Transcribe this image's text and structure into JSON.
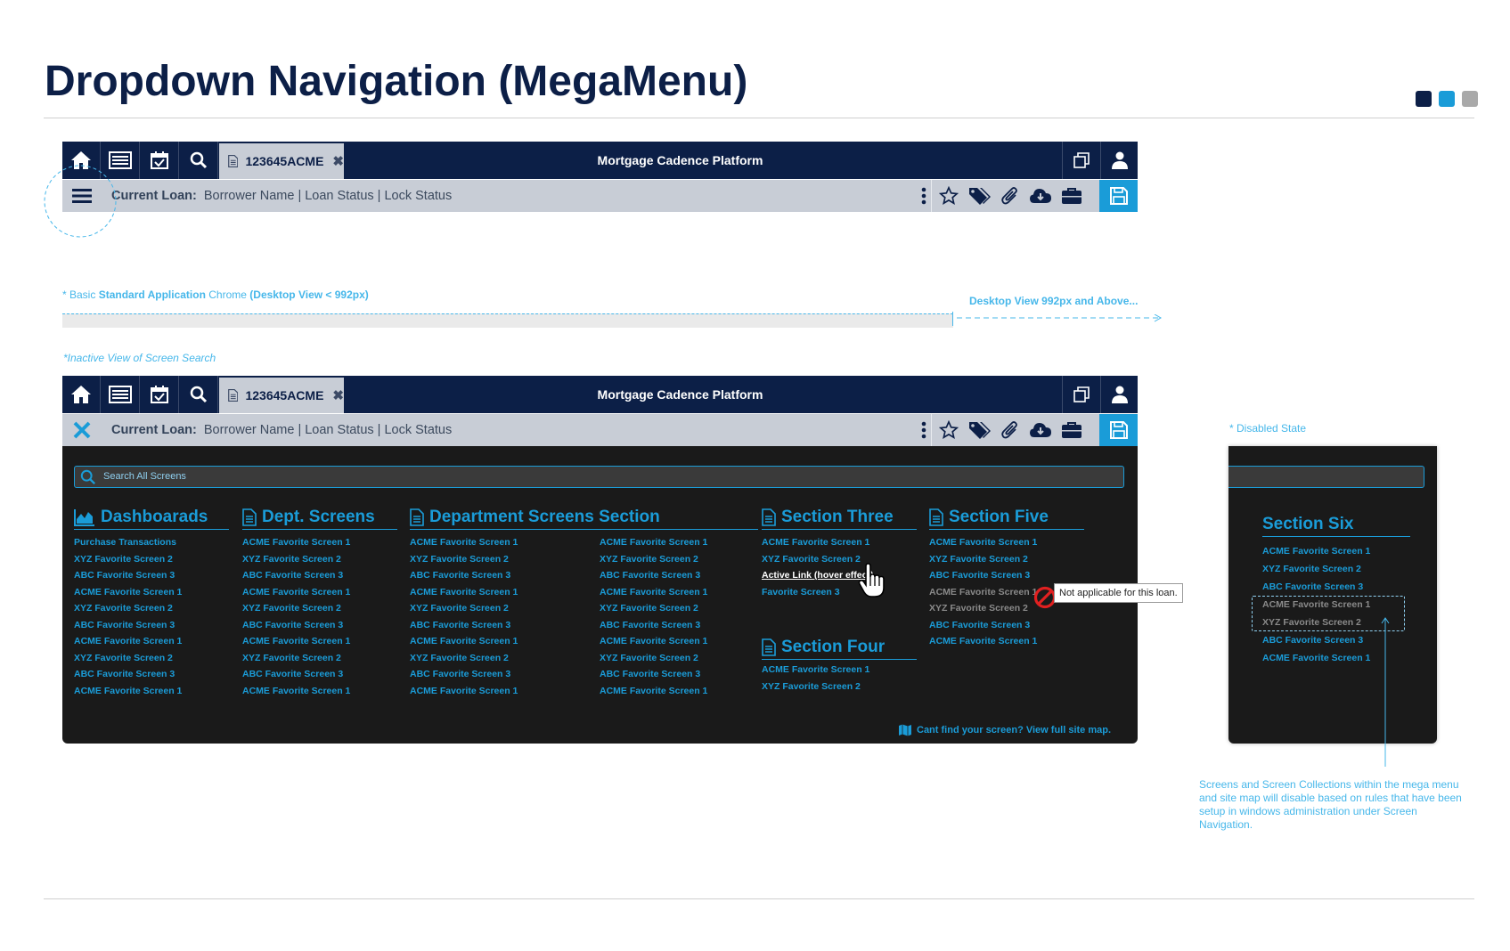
{
  "page": {
    "title": "Dropdown Navigation (MegaMenu)",
    "swatches": [
      "#0c1f47",
      "#1a9cd8",
      "#a9a9a9"
    ]
  },
  "app": {
    "tab_label": "123645ACME",
    "title": "Mortgage Cadence Platform",
    "current_loan_label": "Current Loan:",
    "loan_info": "Borrower Name | Loan Status | Lock Status",
    "icons": [
      "home-icon",
      "list-icon",
      "calendar-icon",
      "search-icon",
      "document-icon",
      "close-icon",
      "copy-window-icon",
      "user-icon",
      "hamburger-icon",
      "kebab-icon",
      "star-icon",
      "tags-icon",
      "paperclip-icon",
      "cloud-download-icon",
      "briefcase-icon",
      "save-icon"
    ]
  },
  "annotations": {
    "basic_chrome_prefix": "* Basic ",
    "basic_chrome_bold": "Standard Application",
    "basic_chrome_mid": " Chrome ",
    "basic_chrome_view": "(Desktop View < 992px)",
    "desktop_above": "Desktop View 992px and Above...",
    "inactive_view": "*Inactive View of Screen Search",
    "disabled_state": "* Disabled State",
    "disable_rule": "Screens and Screen Collections within the mega menu and site map will disable based on rules that have been setup in windows administration under Screen Navigation.",
    "tooltip": "Not applicable for this loan."
  },
  "mega_menu": {
    "search_placeholder": "Search All Screens",
    "columns": [
      {
        "heading": "Dashboarads",
        "icon": "area-chart-icon",
        "links": [
          "Purchase Transactions",
          "XYZ Favorite Screen 2",
          "ABC Favorite Screen 3",
          "ACME Favorite Screen 1",
          "XYZ Favorite Screen 2",
          "ABC Favorite Screen 3",
          "ACME Favorite Screen 1",
          "XYZ Favorite Screen 2",
          "ABC Favorite Screen 3",
          "ACME Favorite Screen 1"
        ]
      },
      {
        "heading": "Dept. Screens",
        "icon": "document-icon",
        "links": [
          "ACME Favorite Screen 1",
          "XYZ Favorite Screen 2",
          "ABC Favorite Screen 3",
          "ACME Favorite Screen 1",
          "XYZ Favorite Screen 2",
          "ABC Favorite Screen 3",
          "ACME Favorite Screen 1",
          "XYZ Favorite Screen 2",
          "ABC Favorite Screen 3",
          "ACME Favorite Screen 1"
        ]
      },
      {
        "heading": "Department Screens Section",
        "icon": "document-icon",
        "links": [
          "ACME Favorite Screen 1",
          "XYZ Favorite Screen 2",
          "ABC Favorite Screen 3",
          "ACME Favorite Screen 1",
          "XYZ Favorite Screen 2",
          "ABC Favorite Screen 3",
          "ACME Favorite Screen 1",
          "XYZ Favorite Screen 2",
          "ABC Favorite Screen 3",
          "ACME Favorite Screen 1"
        ],
        "links2": [
          "ACME Favorite Screen 1",
          "XYZ Favorite Screen 2",
          "ABC Favorite Screen 3",
          "ACME Favorite Screen 1",
          "XYZ Favorite Screen 2",
          "ABC Favorite Screen 3",
          "ACME Favorite Screen 1",
          "XYZ Favorite Screen 2",
          "ABC Favorite Screen 3",
          "ACME Favorite Screen 1"
        ]
      },
      {
        "heading": "Section Three",
        "icon": "document-icon",
        "links": [
          "ACME Favorite Screen 1",
          "XYZ Favorite Screen 2",
          "Active Link (hover effect)",
          "Favorite Screen 3"
        ]
      },
      {
        "heading": "Section Four",
        "icon": "document-icon",
        "links": [
          "ACME Favorite Screen 1",
          "XYZ Favorite Screen 2"
        ]
      },
      {
        "heading": "Section Five",
        "icon": "document-icon",
        "links": [
          "ACME Favorite Screen 1",
          "XYZ Favorite Screen 2",
          "ABC Favorite Screen 3",
          "ACME Favorite Screen 1",
          "XYZ Favorite Screen 2",
          "ABC Favorite Screen 3",
          "ACME Favorite Screen 1"
        ]
      }
    ],
    "site_map_link": "Cant find your screen? View full site map."
  },
  "disabled_panel": {
    "heading": "Section Six",
    "links": [
      "ACME Favorite Screen 1",
      "XYZ Favorite Screen 2",
      "ABC Favorite Screen 3",
      "ACME Favorite Screen 1",
      "XYZ Favorite Screen 2",
      "ABC Favorite Screen 3",
      "ACME Favorite Screen 1"
    ]
  }
}
